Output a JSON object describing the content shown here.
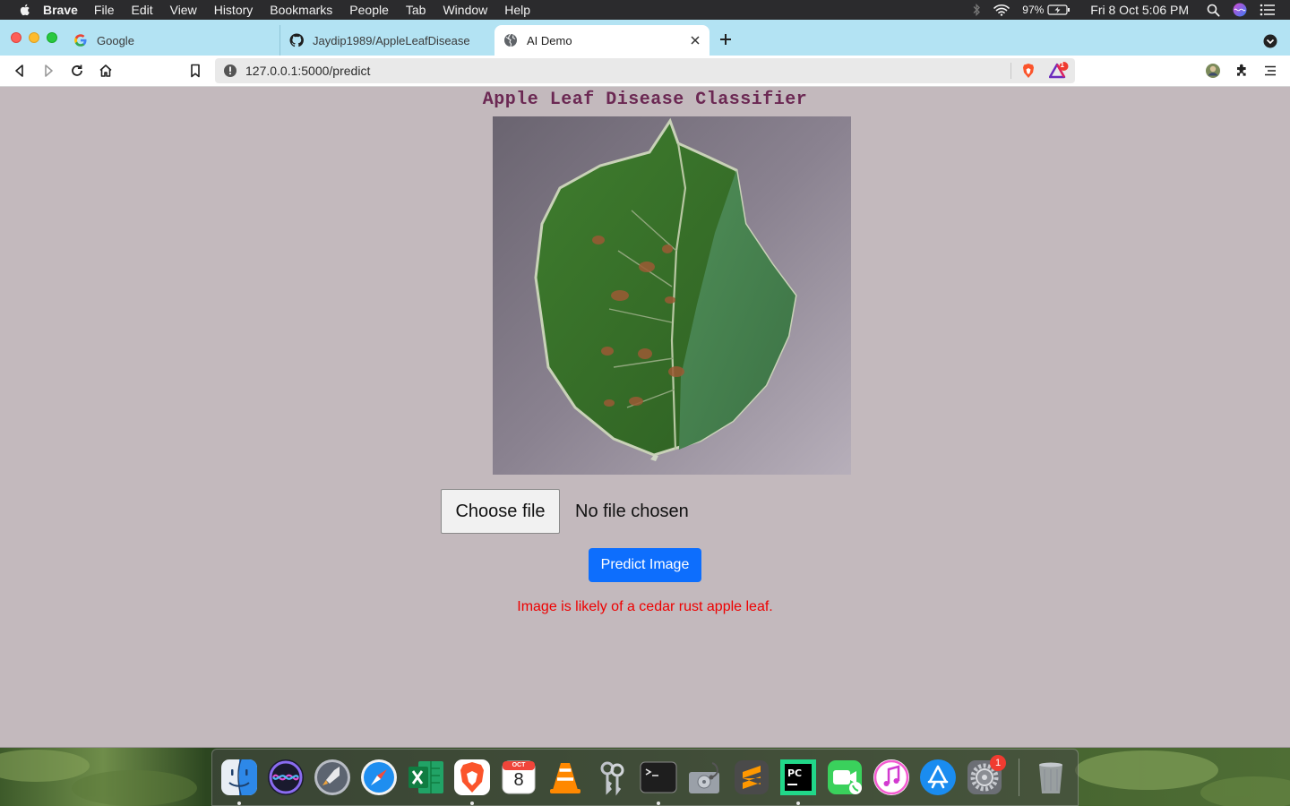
{
  "menubar": {
    "app_name": "Brave",
    "items": [
      "File",
      "Edit",
      "View",
      "History",
      "Bookmarks",
      "People",
      "Tab",
      "Window",
      "Help"
    ],
    "battery": "97%",
    "clock": "Fri 8 Oct  5:06 PM"
  },
  "tabs": [
    {
      "title": "Google",
      "icon": "google-icon",
      "active": false
    },
    {
      "title": "Jaydip1989/AppleLeafDisease",
      "icon": "github-icon",
      "active": false
    },
    {
      "title": "AI Demo",
      "icon": "globe-icon",
      "active": true
    }
  ],
  "toolbar": {
    "url": "127.0.0.1:5000/predict",
    "rewards_badge": "1"
  },
  "page": {
    "title": "Apple Leaf Disease Classifier",
    "choose_file_label": "Choose file",
    "no_file_text": "No file chosen",
    "predict_label": "Predict Image",
    "result_text": "Image is likely of a cedar rust apple leaf.",
    "colors": {
      "background": "#c3b9bd",
      "title": "#6b2853",
      "button": "#0d6efd",
      "result": "#ee0000"
    }
  },
  "dock": {
    "apps": [
      "finder-icon",
      "siri-icon",
      "launchpad-icon",
      "safari-icon",
      "excel-icon",
      "brave-icon",
      "calendar-icon",
      "vlc-icon",
      "keychain-icon",
      "terminal-icon",
      "disk-utility-icon",
      "sublime-text-icon",
      "pycharm-icon",
      "facetime-icon",
      "itunes-icon",
      "app-store-icon",
      "system-preferences-icon",
      "trash-icon"
    ],
    "calendar_month": "OCT",
    "calendar_day": "8",
    "preferences_badge": "1"
  }
}
